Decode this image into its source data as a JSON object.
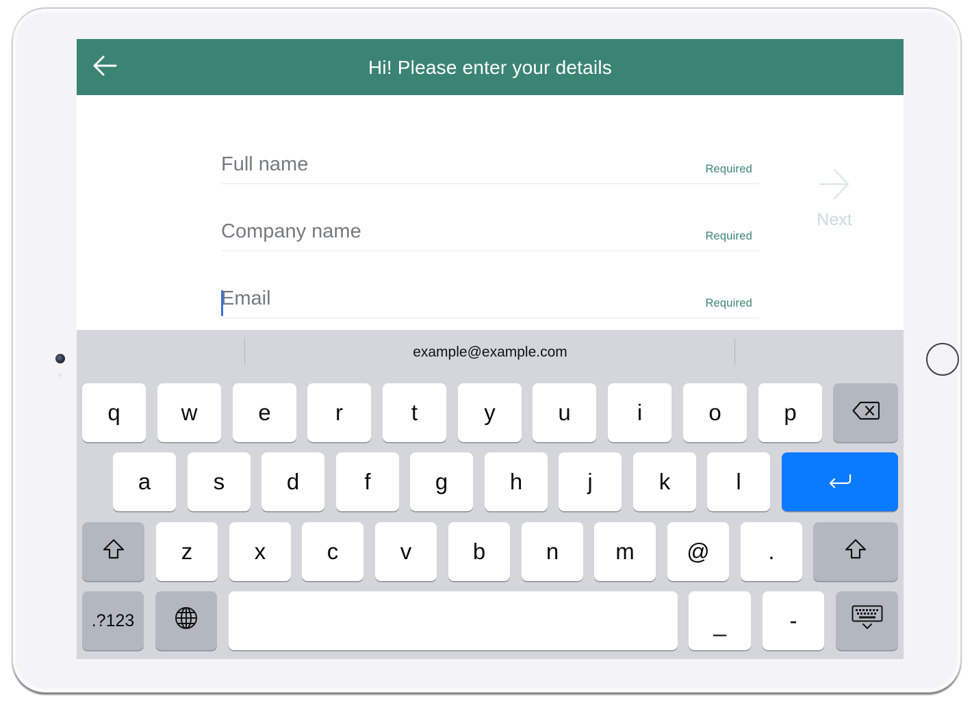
{
  "header": {
    "title": "Hi! Please enter your details",
    "color": "#3b8474"
  },
  "form": {
    "fields": [
      {
        "placeholder": "Full name",
        "badge": "Required",
        "value": ""
      },
      {
        "placeholder": "Company name",
        "badge": "Required",
        "value": ""
      },
      {
        "placeholder": "Email",
        "badge": "Required",
        "value": "",
        "focused": true
      }
    ],
    "next_label": "Next"
  },
  "keyboard": {
    "suggestion": "example@example.com",
    "row1": [
      "q",
      "w",
      "e",
      "r",
      "t",
      "y",
      "u",
      "i",
      "o",
      "p"
    ],
    "row2": [
      "a",
      "s",
      "d",
      "f",
      "g",
      "h",
      "j",
      "k",
      "l"
    ],
    "row3": [
      "z",
      "x",
      "c",
      "v",
      "b",
      "n",
      "m",
      "@",
      "."
    ],
    "row4": {
      "numbers_label": ".?123",
      "underscore": "_",
      "dash": "-"
    },
    "return_color": "#0a7aff",
    "icons": [
      "backspace-icon",
      "return-icon",
      "shift-icon",
      "globe-icon",
      "keyboard-hide-icon"
    ]
  }
}
